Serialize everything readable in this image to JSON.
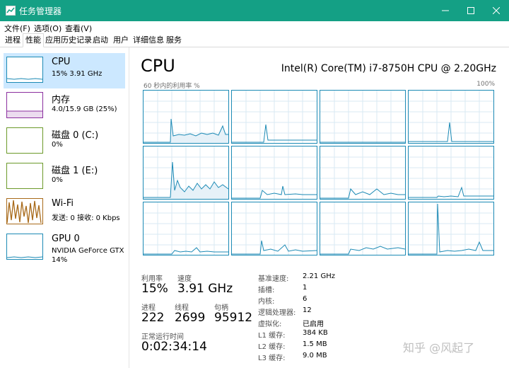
{
  "window": {
    "title": "任务管理器",
    "accent": "#14a085"
  },
  "menu": [
    "文件(F)",
    "选项(O)",
    "查看(V)"
  ],
  "tabs": [
    "进程",
    "性能",
    "应用历史记录",
    "启动",
    "用户",
    "详细信息",
    "服务"
  ],
  "active_tab": "性能",
  "sidebar": [
    {
      "name": "CPU",
      "sub1": "15% 3.91 GHz",
      "sub2": "",
      "color": "#1c8ab5",
      "selected": true
    },
    {
      "name": "内存",
      "sub1": "4.0/15.9 GB (25%)",
      "sub2": "",
      "color": "#8b2f9f",
      "selected": false
    },
    {
      "name": "磁盘 0 (C:)",
      "sub1": "0%",
      "sub2": "",
      "color": "#6c9a2a",
      "selected": false
    },
    {
      "name": "磁盘 1 (E:)",
      "sub1": "0%",
      "sub2": "",
      "color": "#6c9a2a",
      "selected": false
    },
    {
      "name": "Wi-Fi",
      "sub1": "发送: 0 接收: 0 Kbps",
      "sub2": "",
      "color": "#a86a1a",
      "selected": false
    },
    {
      "name": "GPU 0",
      "sub1": "NVIDIA GeForce GTX",
      "sub2": "14%",
      "color": "#1c8ab5",
      "selected": false
    }
  ],
  "main": {
    "title": "CPU",
    "model": "Intel(R) Core(TM) i7-8750H CPU @ 2.20GHz",
    "graph_caption": "60 秒内的利用率 %",
    "graph_max": "100%"
  },
  "stats": {
    "util_label": "利用率",
    "util_value": "15%",
    "speed_label": "速度",
    "speed_value": "3.91 GHz",
    "proc_label": "进程",
    "proc_value": "222",
    "thread_label": "线程",
    "thread_value": "2699",
    "handle_label": "句柄",
    "handle_value": "95912",
    "uptime_label": "正常运行时间",
    "uptime_value": "0:02:34:14"
  },
  "details": [
    {
      "label": "基准速度:",
      "value": "2.21 GHz"
    },
    {
      "label": "插槽:",
      "value": "1"
    },
    {
      "label": "内核:",
      "value": "6"
    },
    {
      "label": "逻辑处理器:",
      "value": "12"
    },
    {
      "label": "虚拟化:",
      "value": "已启用"
    },
    {
      "label": "L1 缓存:",
      "value": "384 KB"
    },
    {
      "label": "L2 缓存:",
      "value": "1.5 MB"
    },
    {
      "label": "L3 缓存:",
      "value": "9.0 MB"
    }
  ],
  "cores": [
    [
      2,
      2,
      2,
      2,
      2,
      2,
      2,
      3,
      2,
      2,
      2,
      2,
      2,
      2,
      2,
      2,
      2,
      2,
      2,
      3,
      2,
      2,
      2,
      2,
      2,
      2,
      2,
      2,
      2,
      2,
      2,
      2,
      2,
      2,
      2,
      2,
      2,
      2,
      2,
      2,
      2,
      2,
      2,
      2,
      2,
      2,
      2,
      2,
      2,
      2,
      2,
      2,
      2,
      2,
      2,
      2,
      2,
      2,
      2,
      2,
      2,
      2,
      2,
      2,
      2,
      2,
      2,
      2,
      2,
      2,
      2,
      2,
      2,
      2,
      2,
      2,
      2,
      2,
      2,
      2
    ],
    [
      1,
      1,
      1,
      1,
      1,
      1,
      1,
      1,
      1,
      1,
      1,
      1,
      1,
      1,
      1,
      1,
      1,
      1,
      1,
      1,
      1,
      1,
      1,
      1,
      1,
      1,
      1,
      1,
      1,
      1,
      1,
      1,
      1,
      1,
      1,
      1,
      1,
      1,
      1,
      1,
      1,
      30,
      6,
      4,
      4,
      4,
      4,
      4,
      4,
      4,
      4,
      4,
      4,
      4,
      4,
      4,
      4,
      4,
      4,
      4,
      4,
      4,
      4,
      4,
      4,
      4,
      4,
      4,
      4,
      4,
      4,
      4,
      4,
      4,
      4,
      4,
      4,
      4,
      4,
      4
    ]
  ],
  "watermark": "知乎 @风起了"
}
